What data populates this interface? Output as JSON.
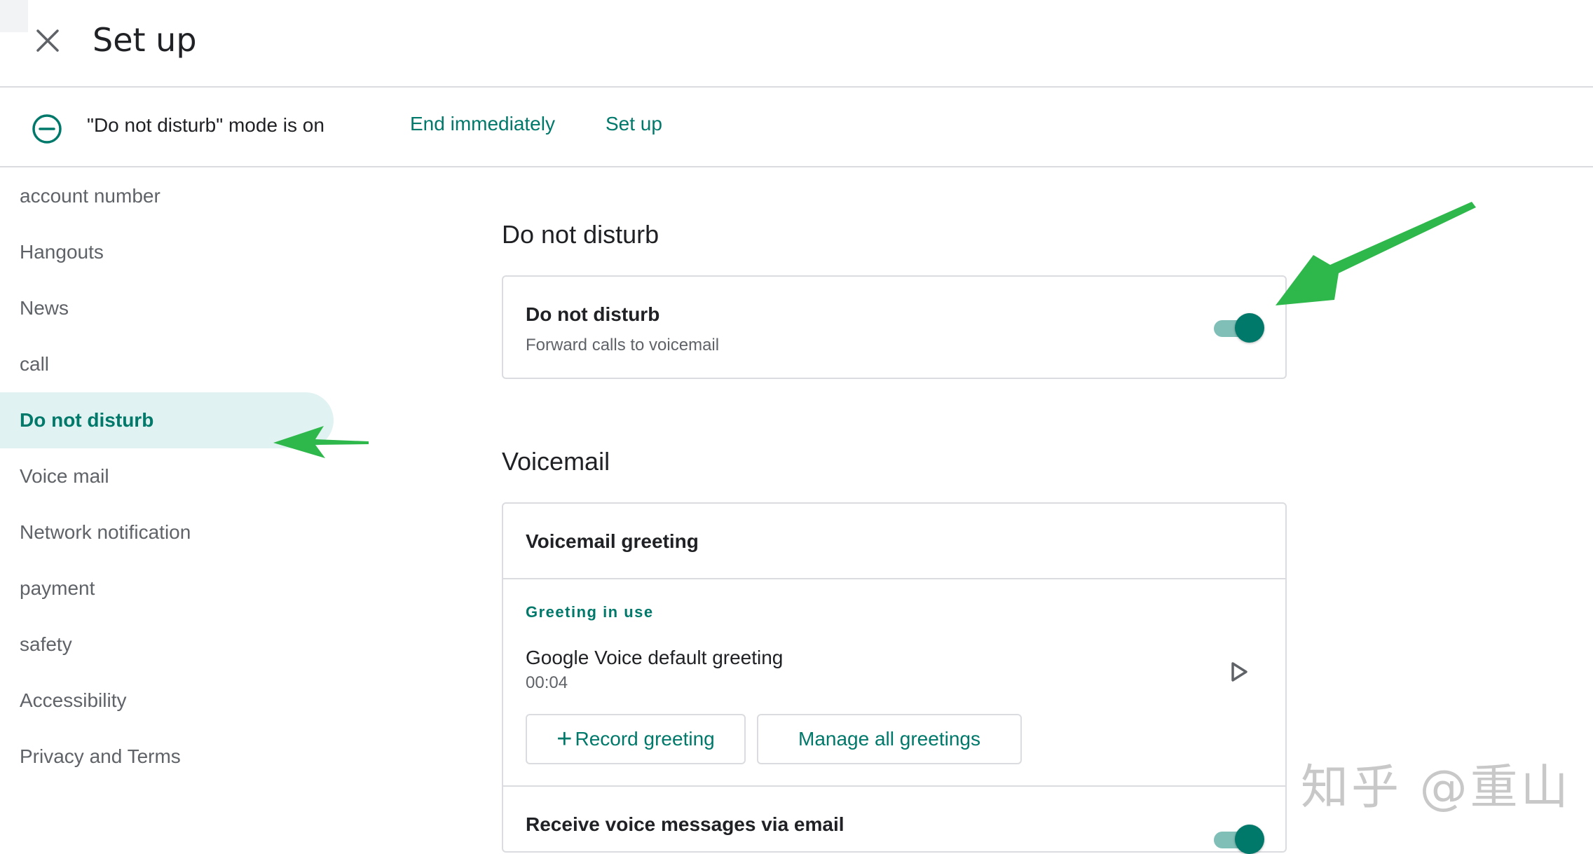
{
  "header": {
    "title": "Set up"
  },
  "banner": {
    "text": "\"Do not disturb\" mode is on",
    "end_label": "End immediately",
    "setup_label": "Set up"
  },
  "sidebar": {
    "items": [
      {
        "label": "account number"
      },
      {
        "label": "Hangouts"
      },
      {
        "label": "News"
      },
      {
        "label": "call"
      },
      {
        "label": "Do not disturb",
        "active": true
      },
      {
        "label": "Voice mail"
      },
      {
        "label": "Network notification"
      },
      {
        "label": "payment"
      },
      {
        "label": "safety"
      },
      {
        "label": "Accessibility"
      },
      {
        "label": "Privacy and Terms"
      }
    ]
  },
  "dnd_section": {
    "title": "Do not disturb",
    "row_title": "Do not disturb",
    "row_sub": "Forward calls to voicemail",
    "toggle_on": true
  },
  "voicemail_section": {
    "title": "Voicemail",
    "greeting_header": "Voicemail greeting",
    "greeting_in_use_label": "Greeting in use",
    "greeting_name": "Google Voice default greeting",
    "greeting_duration": "00:04",
    "record_label": "Record greeting",
    "manage_label": "Manage all greetings",
    "email_row_title": "Receive voice messages via email",
    "email_toggle_on": true
  },
  "watermark": {
    "text": "知乎 @重山"
  },
  "colors": {
    "accent": "#00796b",
    "active_bg": "#e0f2f1",
    "arrow": "#2eb84b"
  }
}
